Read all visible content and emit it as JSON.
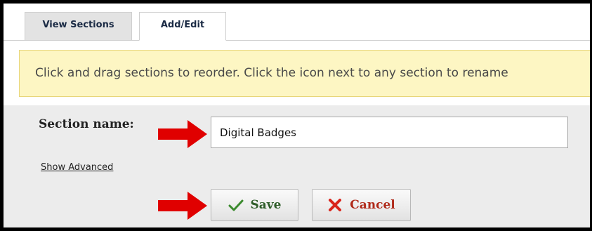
{
  "tabs": [
    {
      "label": "View Sections",
      "active": false
    },
    {
      "label": "Add/Edit",
      "active": true
    }
  ],
  "notice": {
    "text": "Click and drag sections to reorder. Click the icon next to any section to rename"
  },
  "form": {
    "section_name_label": "Section name:",
    "section_name_value": "Digital Badges",
    "show_advanced_label": "Show Advanced"
  },
  "buttons": {
    "save_label": "Save",
    "save_icon": "checkmark-icon",
    "cancel_label": "Cancel",
    "cancel_icon": "x-icon"
  },
  "annotations": {
    "arrow_color": "#e00000",
    "arrow_icon": "right-arrow-icon"
  },
  "colors": {
    "notice_background": "#fdf6c3",
    "panel_background": "#ececec",
    "save_color": "#2f5d2a",
    "cancel_color": "#b02a1a"
  }
}
